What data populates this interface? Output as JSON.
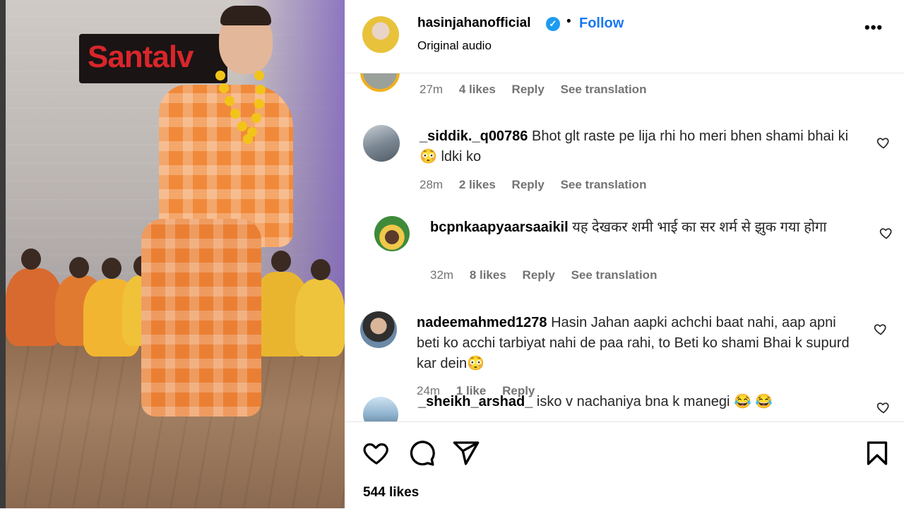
{
  "post": {
    "username": "hasinjahanofficial",
    "follow_label": "Follow",
    "separator": "•",
    "audio": "Original audio",
    "more_label": "•••",
    "likes": "544 likes",
    "verified_glyph": "✓",
    "media_sign_text": "Santalv"
  },
  "comments": [
    {
      "username": "",
      "text": "",
      "time": "27m",
      "likes": "4 likes",
      "reply": "Reply",
      "translate": "See translation"
    },
    {
      "username": "_siddik._q00786",
      "text": "Bhot glt raste pe lija rhi ho meri bhen shami bhai ki 😳 ldki ko",
      "time": "28m",
      "likes": "2 likes",
      "reply": "Reply",
      "translate": "See translation"
    },
    {
      "username": "bcpnkaapyaarsaaikil",
      "text": "यह देखकर शमी भाई का सर शर्म से झुक गया होगा",
      "time": "32m",
      "likes": "8 likes",
      "reply": "Reply",
      "translate": "See translation"
    },
    {
      "username": "nadeemahmed1278",
      "text": "Hasin Jahan aapki achchi baat nahi, aap apni beti ko acchi tarbiyat nahi de paa rahi, to Beti ko shami Bhai k supurd kar dein😳",
      "time": "24m",
      "likes": "1 like",
      "reply": "Reply",
      "translate": ""
    },
    {
      "username": "_sheikh_arshad_",
      "text": "isko v nachaniya bna k manegi 😂 😂",
      "time": "",
      "likes": "",
      "reply": "",
      "translate": ""
    }
  ],
  "icons": {
    "like": "heart-icon",
    "comment": "comment-icon",
    "share": "share-icon",
    "save": "bookmark-icon",
    "more": "more-icon",
    "verified": "verified-icon"
  },
  "colors": {
    "follow": "#1877f2",
    "verified": "#1d9bf0",
    "meta": "#737373"
  }
}
